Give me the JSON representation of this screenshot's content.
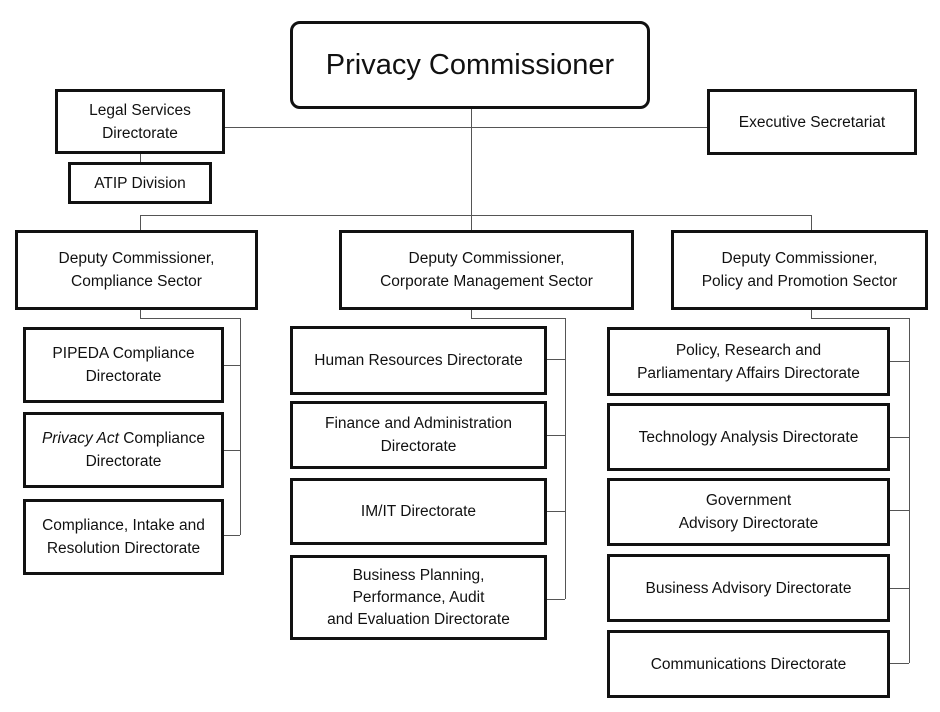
{
  "title": "Privacy Commissioner",
  "staff": {
    "legal": [
      "Legal Services",
      "Directorate"
    ],
    "atip": "ATIP Division",
    "exec": "Executive Secretariat"
  },
  "sectors": [
    {
      "title": [
        "Deputy Commissioner,",
        "Compliance Sector"
      ],
      "units": [
        {
          "lines": [
            "PIPEDA Compliance",
            "Directorate"
          ]
        },
        {
          "italic": "Privacy Act",
          "rest": " Compliance",
          "line2": "Directorate"
        },
        {
          "lines": [
            "Compliance, Intake and",
            "Resolution Directorate"
          ]
        }
      ]
    },
    {
      "title": [
        "Deputy Commissioner,",
        "Corporate Management Sector"
      ],
      "units": [
        {
          "lines": [
            "Human Resources Directorate"
          ]
        },
        {
          "lines": [
            "Finance and Administration",
            "Directorate"
          ]
        },
        {
          "lines": [
            "IM/IT Directorate"
          ]
        },
        {
          "lines": [
            "Business Planning,",
            "Performance, Audit",
            "and Evaluation Directorate"
          ]
        }
      ]
    },
    {
      "title": [
        "Deputy Commissioner,",
        "Policy and Promotion Sector"
      ],
      "units": [
        {
          "lines": [
            "Policy, Research and",
            "Parliamentary Affairs Directorate"
          ]
        },
        {
          "lines": [
            "Technology Analysis Directorate"
          ]
        },
        {
          "lines": [
            "Government",
            "Advisory Directorate"
          ]
        },
        {
          "lines": [
            "Business Advisory Directorate"
          ]
        },
        {
          "lines": [
            "Communications Directorate"
          ]
        }
      ]
    }
  ]
}
